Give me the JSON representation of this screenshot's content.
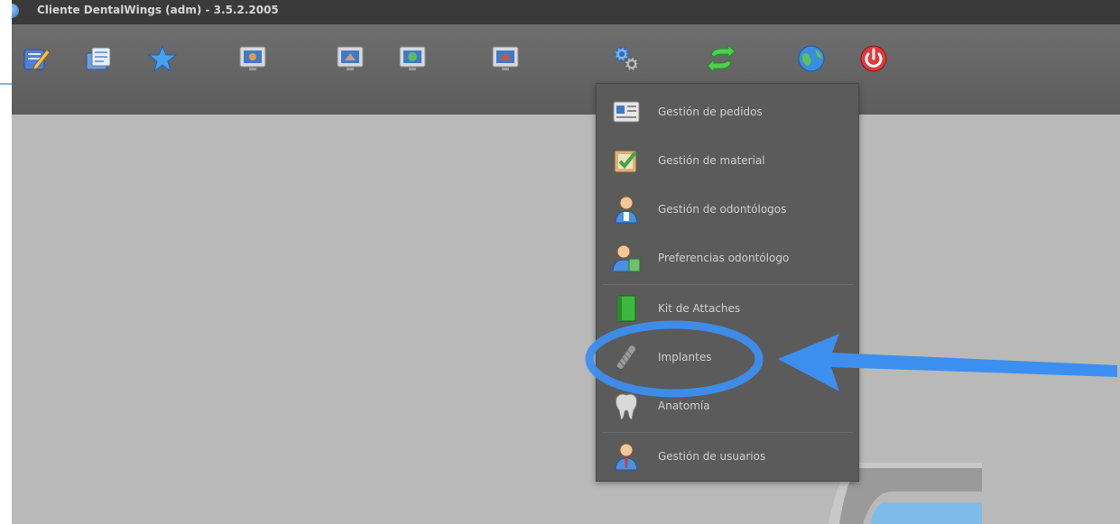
{
  "window": {
    "title": "Cliente DentalWings (adm) - 3.5.2.2005"
  },
  "toolbar": {
    "buttons": [
      {
        "name": "edit",
        "icon": "edit-note-icon"
      },
      {
        "name": "documents",
        "icon": "documents-icon"
      },
      {
        "name": "favorites",
        "icon": "star-icon"
      },
      {
        "name": "monitor-1",
        "icon": "monitor-icon"
      },
      {
        "name": "monitor-2",
        "icon": "monitor-icon"
      },
      {
        "name": "monitor-3",
        "icon": "monitor-icon"
      },
      {
        "name": "monitor-4",
        "icon": "monitor-icon"
      },
      {
        "name": "settings",
        "icon": "gears-icon"
      },
      {
        "name": "sync",
        "icon": "sync-arrows-icon"
      },
      {
        "name": "internet",
        "icon": "globe-icon"
      },
      {
        "name": "power",
        "icon": "power-icon"
      }
    ]
  },
  "menu": {
    "items": [
      {
        "label": "Gestión de pedidos",
        "icon": "orders-icon"
      },
      {
        "label": "Gestión de material",
        "icon": "material-icon"
      },
      {
        "label": "Gestión de odontólogos",
        "icon": "dentist-user-icon"
      },
      {
        "label": "Preferencias odontólogo",
        "icon": "dentist-preferences-icon"
      },
      {
        "label": "Kit de Attaches",
        "icon": "green-binder-icon"
      },
      {
        "label": "Implantes",
        "icon": "implant-icon"
      },
      {
        "label": "Anatomía",
        "icon": "tooth-icon"
      },
      {
        "label": "Gestión de usuarios",
        "icon": "user-icon"
      }
    ]
  },
  "colors": {
    "annotation": "#3d8fef",
    "toolbar": "#636363",
    "workspace": "#b9b9b9",
    "menu": "#5b5b5b"
  }
}
